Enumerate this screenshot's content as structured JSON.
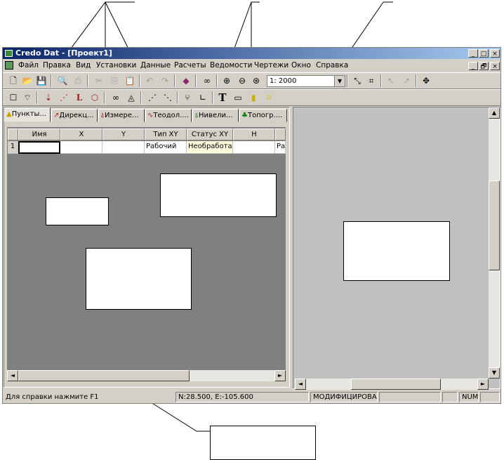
{
  "window": {
    "title": "Credo Dat - [Проект1]",
    "controls": [
      "_",
      "□",
      "×"
    ],
    "child_controls": [
      "_",
      "🗗",
      "×"
    ]
  },
  "menu": [
    "Файл",
    "Правка",
    "Вид",
    "Установки",
    "Данные",
    "Расчеты",
    "Ведомости",
    "Чертежи",
    "Окно",
    "Справка"
  ],
  "toolbar": {
    "scale_value": "1: 2000"
  },
  "tabs": [
    "Пункты...",
    "Дирекц...",
    "Измере...",
    "Теодол....",
    "Нивели...",
    "Топогр...."
  ],
  "table": {
    "columns": [
      "Имя",
      "X",
      "Y",
      "Тип XY",
      "Статус XY",
      "H"
    ],
    "rows": [
      {
        "num": "1",
        "name": "",
        "x": "",
        "y": "",
        "type_xy": "Рабочий",
        "status_xy": "Необработан",
        "h": "",
        "extra": "Раб"
      }
    ]
  },
  "statusbar": {
    "help": "Для справки нажмите  F1",
    "coords": "N:28.500, E:-105.600",
    "state": "МОДИФИЦИРОВАН",
    "num": "NUM"
  },
  "colors": {
    "titlebar_start": "#0a246a",
    "titlebar_end": "#a6caf0",
    "face": "#d4d0c8",
    "grid_bg": "#808080"
  }
}
